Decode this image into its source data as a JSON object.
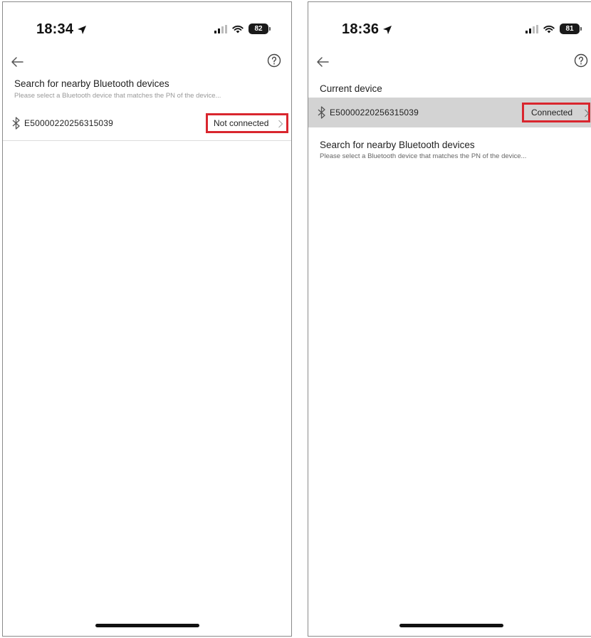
{
  "screens": [
    {
      "status_bar": {
        "time": "18:34",
        "battery": "82"
      },
      "search_section": {
        "title": "Search for nearby Bluetooth devices",
        "subtitle": "Please select a Bluetooth device that matches the PN of the device..."
      },
      "devices": [
        {
          "name": "E50000220256315039",
          "status": "Not connected"
        }
      ]
    },
    {
      "status_bar": {
        "time": "18:36",
        "battery": "81"
      },
      "current_section": {
        "title": "Current device"
      },
      "current_device": {
        "name": "E50000220256315039",
        "status": "Connected"
      },
      "search_section": {
        "title": "Search for nearby Bluetooth devices",
        "subtitle": "Please select a Bluetooth device that matches the PN of the device..."
      }
    }
  ],
  "colors": {
    "highlight_border": "#d9262e",
    "current_row_bg": "#d3d3d3",
    "frame": "#8a8a8a"
  },
  "icons": {
    "back": "arrow-left-icon",
    "help": "question-circle-icon",
    "bluetooth": "bluetooth-icon",
    "chevron": "chevron-right-icon",
    "location": "location-arrow-icon",
    "signal": "cellular-signal-icon",
    "wifi": "wifi-icon",
    "battery": "battery-icon"
  }
}
